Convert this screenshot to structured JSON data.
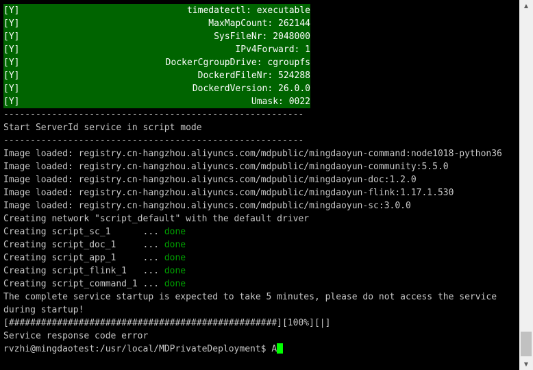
{
  "checks": [
    {
      "flag": "[Y]",
      "text": "timedatectl: executable"
    },
    {
      "flag": "[Y]",
      "text": "MaxMapCount: 262144"
    },
    {
      "flag": "[Y]",
      "text": "SysFileNr: 2048000"
    },
    {
      "flag": "[Y]",
      "text": "IPv4Forward: 1"
    },
    {
      "flag": "[Y]",
      "text": "DockerCgroupDrive: cgroupfs"
    },
    {
      "flag": "[Y]",
      "text": "DockerdFileNr: 524288"
    },
    {
      "flag": "[Y]",
      "text": "DockerdVersion: 26.0.0"
    },
    {
      "flag": "[Y]",
      "text": "Umask: 0022"
    }
  ],
  "separator": "--------------------------------------------------------",
  "start_message": "Start ServerId service in script mode",
  "images": [
    "Image loaded: registry.cn-hangzhou.aliyuncs.com/mdpublic/mingdaoyun-command:node1018-python36",
    "Image loaded: registry.cn-hangzhou.aliyuncs.com/mdpublic/mingdaoyun-community:5.5.0",
    "Image loaded: registry.cn-hangzhou.aliyuncs.com/mdpublic/mingdaoyun-doc:1.2.0",
    "Image loaded: registry.cn-hangzhou.aliyuncs.com/mdpublic/mingdaoyun-flink:1.17.1.530",
    "Image loaded: registry.cn-hangzhou.aliyuncs.com/mdpublic/mingdaoyun-sc:3.0.0"
  ],
  "network_message": "Creating network \"script_default\" with the default driver",
  "creating": [
    {
      "text": "Creating script_sc_1      ... ",
      "status": "done"
    },
    {
      "text": "Creating script_doc_1     ... ",
      "status": "done"
    },
    {
      "text": "Creating script_app_1     ... ",
      "status": "done"
    },
    {
      "text": "Creating script_flink_1   ... ",
      "status": "done"
    },
    {
      "text": "Creating script_command_1 ... ",
      "status": "done"
    }
  ],
  "startup_notice_1": "The complete service startup is expected to take 5 minutes, please do not access the service",
  "startup_notice_2": "during startup!",
  "progress_text": "[##################################################][100%][|]",
  "progress_percent": 100,
  "error_message": "Service response code error",
  "prompt": "rvzhi@mingdaotest:/usr/local/MDPrivateDeployment$ ",
  "typed_input": "A",
  "colors": {
    "check_bg": "#006400",
    "done": "#00a000",
    "cursor": "#00ff00",
    "text": "#c8c8c8"
  },
  "scrollbar": {
    "up_icon": "triangle-up",
    "down_icon": "triangle-down",
    "position": 1.0
  }
}
